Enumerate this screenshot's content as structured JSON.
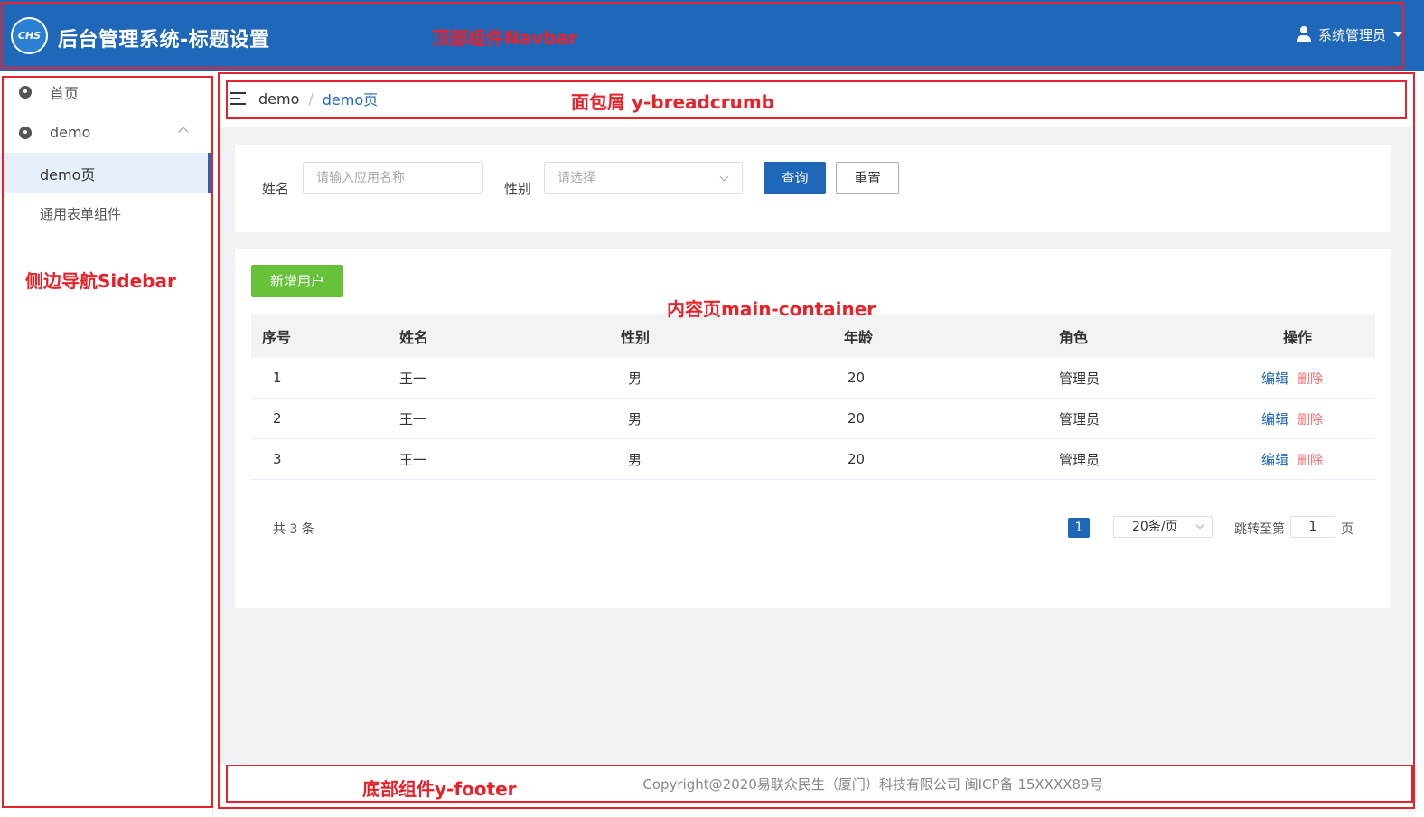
{
  "navbar": {
    "logo_text": "CHS",
    "title": "后台管理系统-标题设置",
    "user_name": "系统管理员"
  },
  "sidebar": {
    "items": [
      {
        "label": "首页",
        "icon": "dashboard-icon"
      },
      {
        "label": "demo",
        "icon": "dashboard-icon",
        "expanded": true,
        "children": [
          {
            "label": "demo页",
            "active": true
          },
          {
            "label": "通用表单组件",
            "active": false
          }
        ]
      }
    ]
  },
  "breadcrumb": {
    "home": "demo",
    "separator": "/",
    "current": "demo页"
  },
  "search": {
    "name_label": "姓名",
    "name_placeholder": "请输入应用名称",
    "gender_label": "性别",
    "gender_placeholder": "请选择",
    "query_button": "查询",
    "reset_button": "重置"
  },
  "table": {
    "add_button": "新增用户",
    "columns": [
      "序号",
      "姓名",
      "性别",
      "年龄",
      "角色",
      "操作"
    ],
    "rows": [
      {
        "index": "1",
        "name": "王一",
        "gender": "男",
        "age": "20",
        "role": "管理员"
      },
      {
        "index": "2",
        "name": "王一",
        "gender": "男",
        "age": "20",
        "role": "管理员"
      },
      {
        "index": "3",
        "name": "王一",
        "gender": "男",
        "age": "20",
        "role": "管理员"
      }
    ],
    "action_edit": "编辑",
    "action_delete": "删除"
  },
  "pagination": {
    "total_text": "共 3 条",
    "current_page": "1",
    "page_size": "20条/页",
    "jump_label": "跳转至第",
    "jump_value": "1",
    "jump_unit": "页"
  },
  "footer": {
    "copyright": "Copyright@2020易联众民生（厦门）科技有限公司 闽ICP备 15XXXX89号"
  },
  "annotations": {
    "navbar": "顶部组件Navbar",
    "breadcrumb": "面包屑  y-breadcrumb",
    "sidebar": "侧边导航Sidebar",
    "main": "内容页main-container",
    "footer": "底部组件y-footer"
  },
  "colors": {
    "primary": "#1f67b8",
    "success": "#67c23a",
    "danger": "#f56c6c",
    "annotation": "#e8222a"
  }
}
